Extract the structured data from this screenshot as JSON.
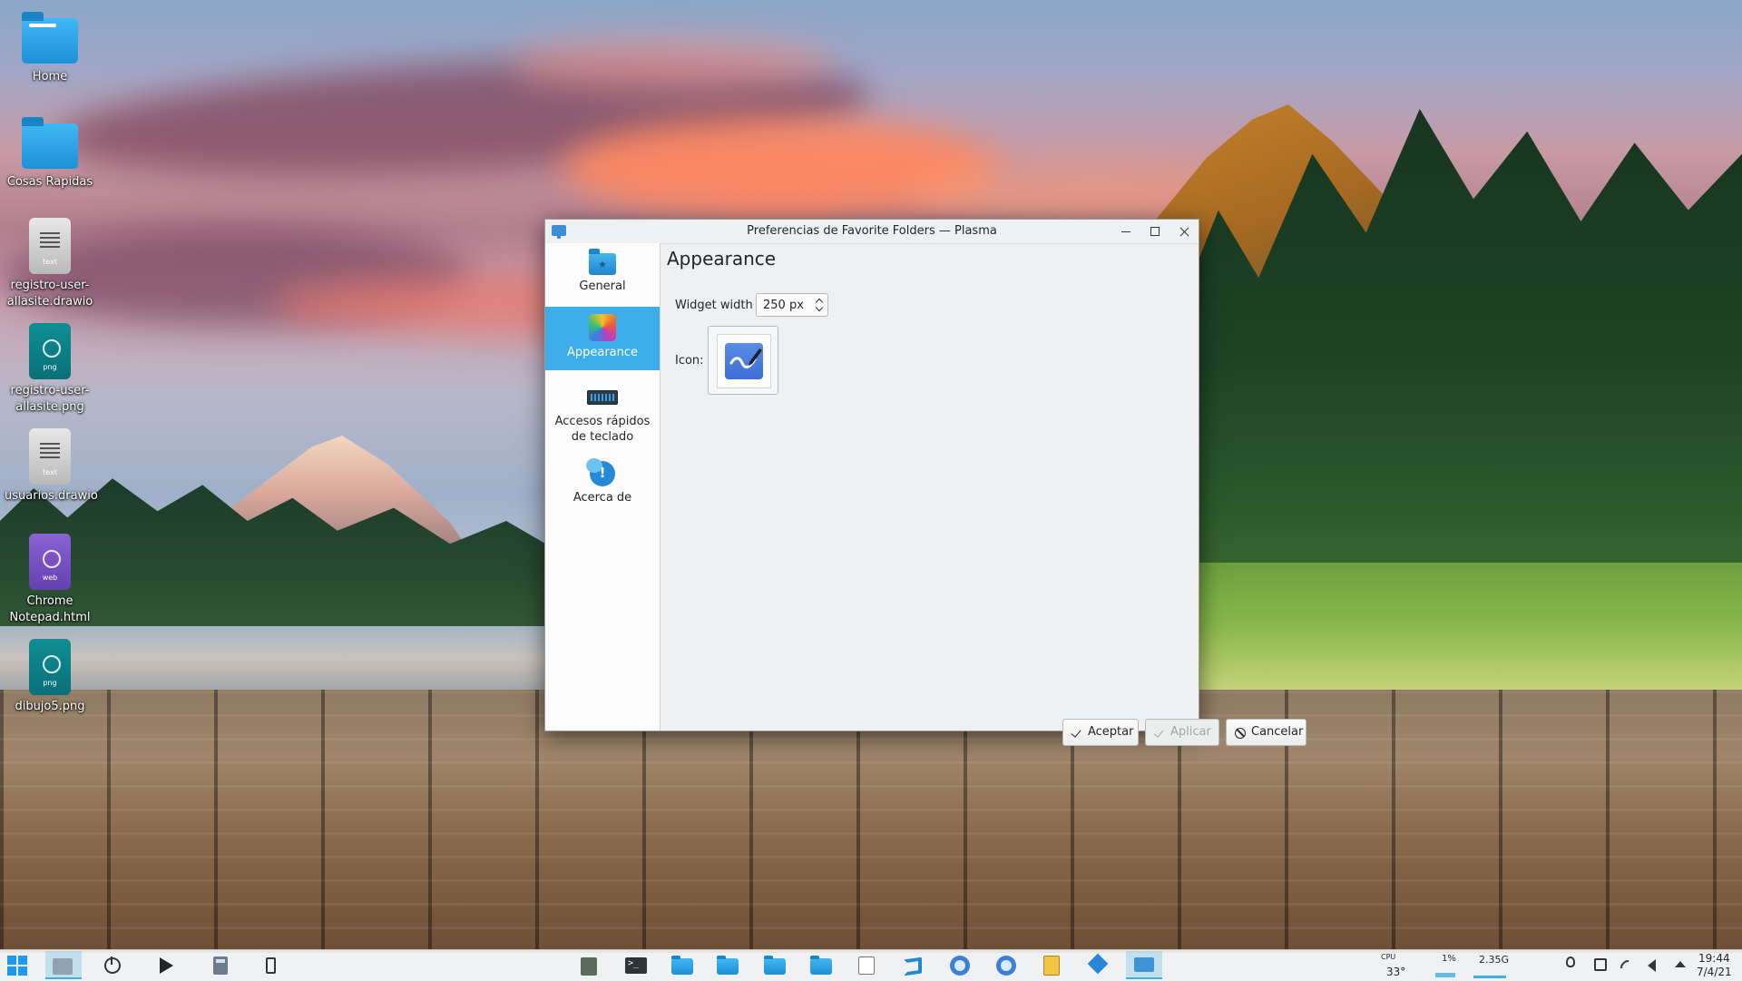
{
  "desktop": {
    "icons": [
      {
        "label": "Home",
        "type": "folder"
      },
      {
        "label": "Cosas Rapidas",
        "type": "folder"
      },
      {
        "label": "registro-user-allasite.drawio",
        "ext": "text"
      },
      {
        "label": "registro-user-allasite.png",
        "ext": "png"
      },
      {
        "label": "usuarios.drawio",
        "ext": "text"
      },
      {
        "label": "Chrome Notepad.html",
        "ext": "web"
      },
      {
        "label": "dibujo5.png",
        "ext": "png"
      }
    ]
  },
  "dialog": {
    "title": "Preferencias de Favorite Folders — Plasma",
    "sidebar": [
      {
        "label": "General",
        "icon": "folder-star-icon",
        "selected": false
      },
      {
        "label": "Appearance",
        "icon": "color-palette-icon",
        "selected": true
      },
      {
        "label": "Accesos rápidos de teclado",
        "icon": "keyboard-icon",
        "selected": false
      },
      {
        "label": "Acerca de",
        "icon": "about-info-icon",
        "selected": false
      }
    ],
    "page": {
      "title": "Appearance",
      "widget_width_label": "Widget width",
      "widget_width_value": "250 px",
      "icon_label": "Icon:",
      "icon_name": "pen-drawing-icon"
    },
    "buttons": {
      "ok": "Aceptar",
      "apply": "Aplicar",
      "cancel": "Cancelar",
      "apply_enabled": false
    }
  },
  "taskbar": {
    "cpu_label": "CPU",
    "cpu_temp": "33°",
    "cpu_usage": "1%",
    "memory": "2.35G",
    "time": "19:44",
    "date": "7/4/21"
  },
  "colors": {
    "accent": "#3daee9",
    "window_bg": "#eff0f1",
    "sidebar_bg": "#fcfcfc",
    "folder_blue": "#1e90d8"
  }
}
